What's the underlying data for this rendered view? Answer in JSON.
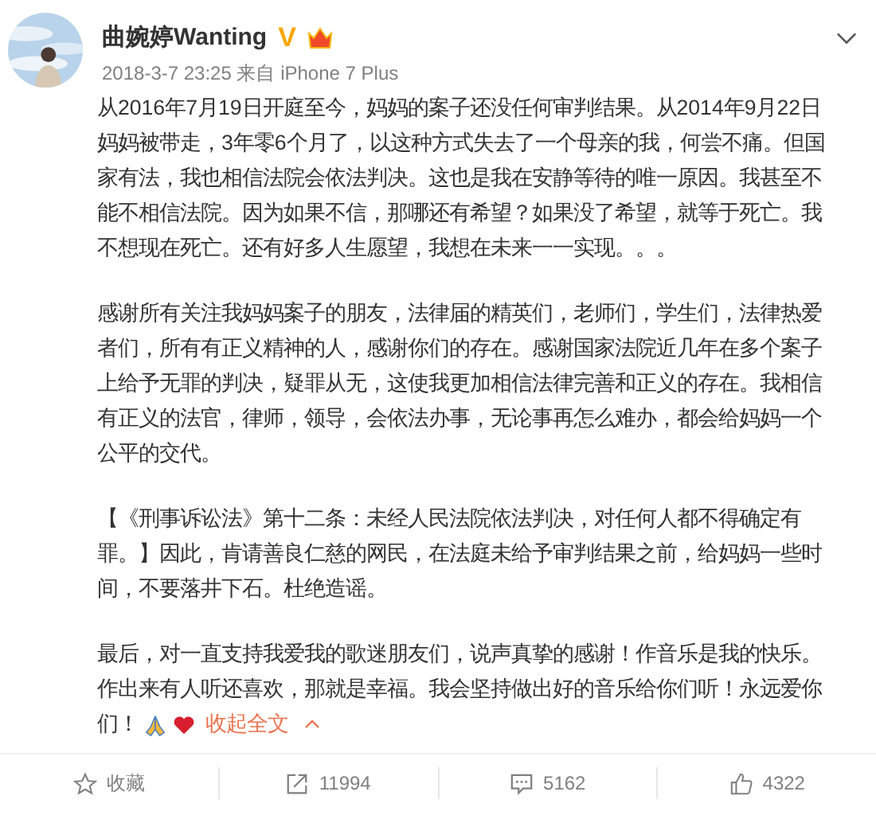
{
  "author": {
    "name": "曲婉婷Wanting",
    "verified_mark": "V",
    "meta": "2018-3-7 23:25 来自 iPhone 7 Plus"
  },
  "paragraphs": [
    {
      "lines": [
        "从2016年7月19日开庭至今，妈妈的案子还没任何审判结果。从2014年9月22日",
        "妈妈被带走，3年零6个月了，以这种方式失去了一个母亲的我，何尝不痛。但国",
        "家有法，我也相信法院会依法判决。这也是我在安静等待的唯一原因。我甚至不",
        "能不相信法院。因为如果不信，那哪还有希望？如果没了希望，就等于死亡。我",
        "不想现在死亡。还有好多人生愿望，我想在未来一一实现。。。"
      ]
    },
    {
      "lines": [
        "感谢所有关注我妈妈案子的朋友，法律届的精英们，老师们，学生们，法律热爱",
        "者们，所有有正义精神的人，感谢你们的存在。感谢国家法院近几年在多个案子",
        "上给予无罪的判决，疑罪从无，这使我更加相信法律完善和正义的存在。我相信",
        "有正义的法官，律师，领导，会依法办事，无论事再怎么难办，都会给妈妈一个",
        "公平的交代。"
      ]
    },
    {
      "lines": [
        "【《刑事诉讼法》第十二条：未经人民法院依法判决，对任何人都不得确定有",
        "罪。】因此，肯请善良仁慈的网民，在法庭未给予审判结果之前，给妈妈一些时",
        "间，不要落井下石。杜绝造谣。"
      ]
    },
    {
      "lines": [
        "最后，对一直支持我爱我的歌迷朋友们，说声真挚的感谢！作音乐是我的快乐。",
        "作出来有人听还喜欢，那就是幸福。我会坚持做出好的音乐给你们听！永远爱你",
        "们！"
      ]
    }
  ],
  "collapse_link": "收起全文",
  "actions": [
    {
      "kind": "favorite",
      "label": "收藏"
    },
    {
      "kind": "repost",
      "label": "11994"
    },
    {
      "kind": "comment",
      "label": "5162"
    },
    {
      "kind": "like",
      "label": "4322"
    }
  ]
}
